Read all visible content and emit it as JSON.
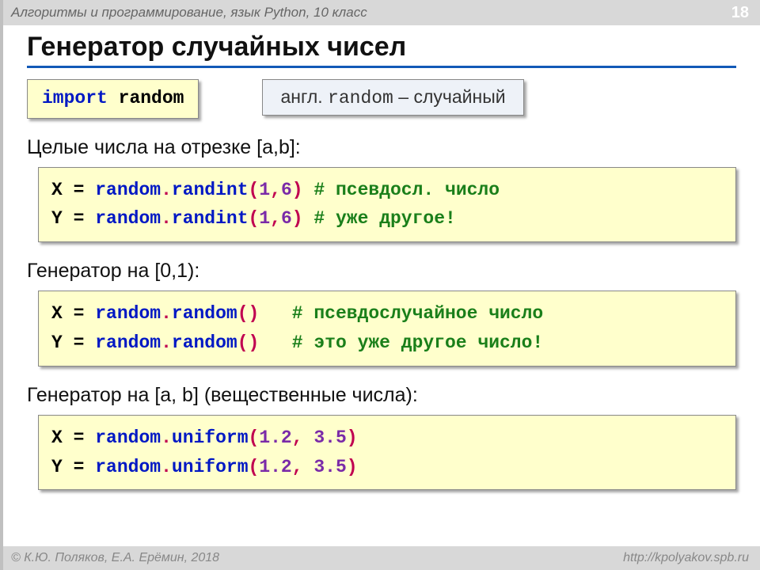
{
  "top": {
    "breadcrumb": "Алгоритмы и программирование, язык Python, 10 класс",
    "page": "18"
  },
  "title": "Генератор случайных чисел",
  "importBox": {
    "kw": "import",
    "mod": "random"
  },
  "note": {
    "text_before": "англ. ",
    "word": "random",
    "text_after": " – случайный"
  },
  "sec1": {
    "heading": "Целые числа на отрезке [a,b]:",
    "l1": {
      "v": "X",
      "eq": "=",
      "sp": " ",
      "mod": "random",
      "dot": ".",
      "fn": "randint",
      "lp": "(",
      "a1": "1",
      "cm": ",",
      "a2": "6",
      "rp": ")",
      "gap": " ",
      "c": "# псевдосл. число"
    },
    "l2": {
      "v": "Y",
      "eq": "=",
      "sp": " ",
      "mod": "random",
      "dot": ".",
      "fn": "randint",
      "lp": "(",
      "a1": "1",
      "cm": ",",
      "a2": "6",
      "rp": ")",
      "gap": " ",
      "c": "# уже другое!"
    }
  },
  "sec2": {
    "heading": "Генератор на [0,1):",
    "l1": {
      "v": "X",
      "eq": "=",
      "sp": " ",
      "mod": "random",
      "dot": ".",
      "fn": "random",
      "lp": "(",
      "rp": ")",
      "gap": "   ",
      "c": "# псевдослучайное число"
    },
    "l2": {
      "v": "Y",
      "eq": "=",
      "sp": " ",
      "mod": "random",
      "dot": ".",
      "fn": "random",
      "lp": "(",
      "rp": ")",
      "gap": "   ",
      "c": "# это уже другое число!"
    }
  },
  "sec3": {
    "heading": "Генератор на [a, b] (вещественные числа):",
    "l1": {
      "v": "X",
      "eq": "=",
      "sp": " ",
      "mod": "random",
      "dot": ".",
      "fn": "uniform",
      "lp": "(",
      "a1": "1.2",
      "cm": ",",
      "sp2": " ",
      "a2": "3.5",
      "rp": ")"
    },
    "l2": {
      "v": "Y",
      "eq": "=",
      "sp": " ",
      "mod": "random",
      "dot": ".",
      "fn": "uniform",
      "lp": "(",
      "a1": "1.2",
      "cm": ",",
      "sp2": " ",
      "a2": "3.5",
      "rp": ")"
    }
  },
  "footer": {
    "left": "© К.Ю. Поляков, Е.А. Ерёмин, 2018",
    "right": "http://kpolyakov.spb.ru"
  }
}
